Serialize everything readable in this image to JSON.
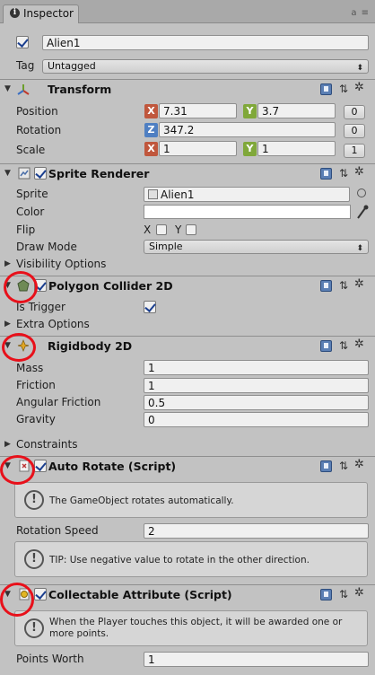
{
  "tab": {
    "label": "Inspector",
    "icon": "info-icon",
    "tools": "a ≡"
  },
  "gameobject": {
    "name": "Alien1",
    "active": true,
    "tag_label": "Tag",
    "tag_value": "Untagged"
  },
  "transform": {
    "title": "Transform",
    "position": {
      "label": "Position",
      "x": "7.31",
      "y": "3.7",
      "reset": "0"
    },
    "rotation": {
      "label": "Rotation",
      "z": "347.2",
      "reset": "0"
    },
    "scale": {
      "label": "Scale",
      "x": "1",
      "y": "1",
      "reset": "1"
    },
    "axis_x": "X",
    "axis_y": "Y",
    "axis_z": "Z"
  },
  "sprite_renderer": {
    "title": "Sprite Renderer",
    "sprite_label": "Sprite",
    "sprite_value": "Alien1",
    "color_label": "Color",
    "flip_label": "Flip",
    "flip_x": "X",
    "flip_y": "Y",
    "draw_mode_label": "Draw Mode",
    "draw_mode_value": "Simple",
    "visibility_label": "Visibility Options"
  },
  "polygon_collider": {
    "title": "Polygon Collider 2D",
    "is_trigger_label": "Is Trigger",
    "extra_options_label": "Extra Options"
  },
  "rigidbody": {
    "title": "Rigidbody 2D",
    "mass_label": "Mass",
    "mass_value": "1",
    "friction_label": "Friction",
    "friction_value": "1",
    "angular_label": "Angular Friction",
    "angular_value": "0.5",
    "gravity_label": "Gravity",
    "gravity_value": "0",
    "constraints_label": "Constraints"
  },
  "auto_rotate": {
    "title": "Auto Rotate (Script)",
    "help": "The GameObject rotates automatically.",
    "speed_label": "Rotation Speed",
    "speed_value": "2",
    "tip": "TIP: Use negative value to rotate in the other direction."
  },
  "collectable": {
    "title": "Collectable Attribute (Script)",
    "help": "When the Player touches this object, it will be awarded one or more points.",
    "points_label": "Points Worth",
    "points_value": "1"
  },
  "header_icons": {
    "help": "!",
    "settings": "⇅",
    "gear": "✲"
  }
}
